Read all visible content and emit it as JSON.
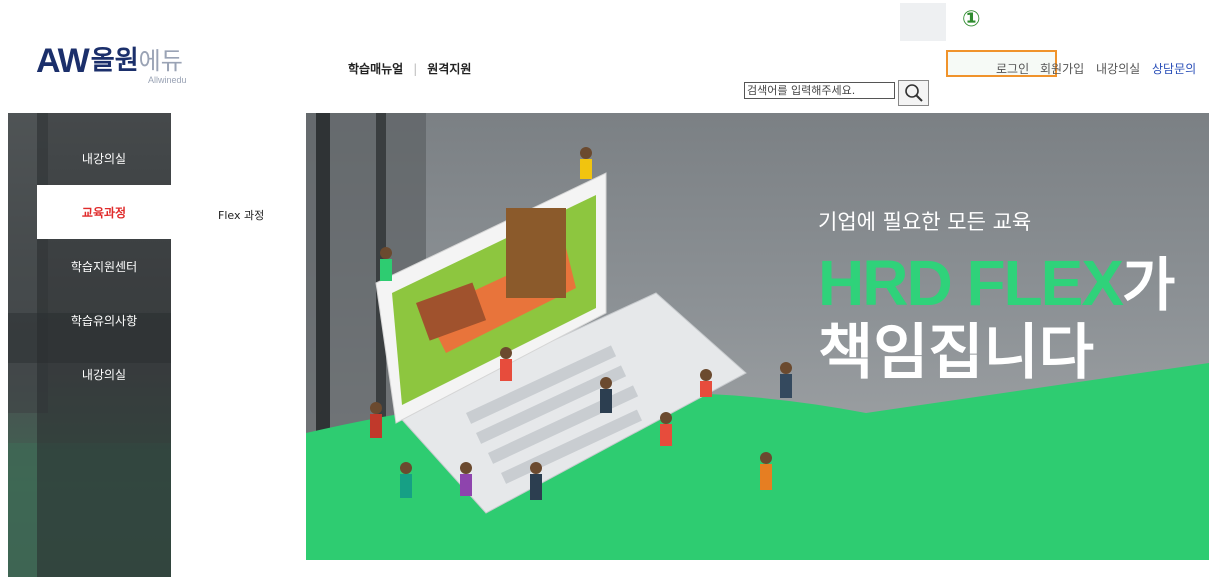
{
  "header": {
    "logo": {
      "mark": "AW",
      "korean_bold": "올원",
      "korean_light": "에듀",
      "sub": "Allwinedu"
    },
    "nav": {
      "manual": "학습매뉴얼",
      "separator": "|",
      "remote": "원격지원"
    },
    "marker": "①",
    "util": {
      "login": "로그인",
      "join": "회원가입",
      "classroom": "내강의실",
      "consult": "상담문의"
    },
    "search": {
      "placeholder": "검색어를 입력해주세요.",
      "icon": "search-icon"
    }
  },
  "sidebar": {
    "items": [
      {
        "label": "내강의실",
        "active": false
      },
      {
        "label": "교육과정",
        "active": true
      },
      {
        "label": "학습지원센터",
        "active": false
      },
      {
        "label": "학습유의사항",
        "active": false
      },
      {
        "label": "내강의실",
        "active": false
      }
    ],
    "sub_items": [
      {
        "label": "Flex 과정"
      }
    ]
  },
  "banner": {
    "subtitle": "기업에 필요한 모든 교육",
    "title_accent": "HRD FLEX",
    "title_suffix": "가",
    "title_line2": "책임집니다"
  },
  "colors": {
    "brand": "#1b2f6b",
    "accent_green": "#2fd27a",
    "active_red": "#e02b2b",
    "highlight": "#f0932b",
    "consult_blue": "#2a4fb8"
  }
}
